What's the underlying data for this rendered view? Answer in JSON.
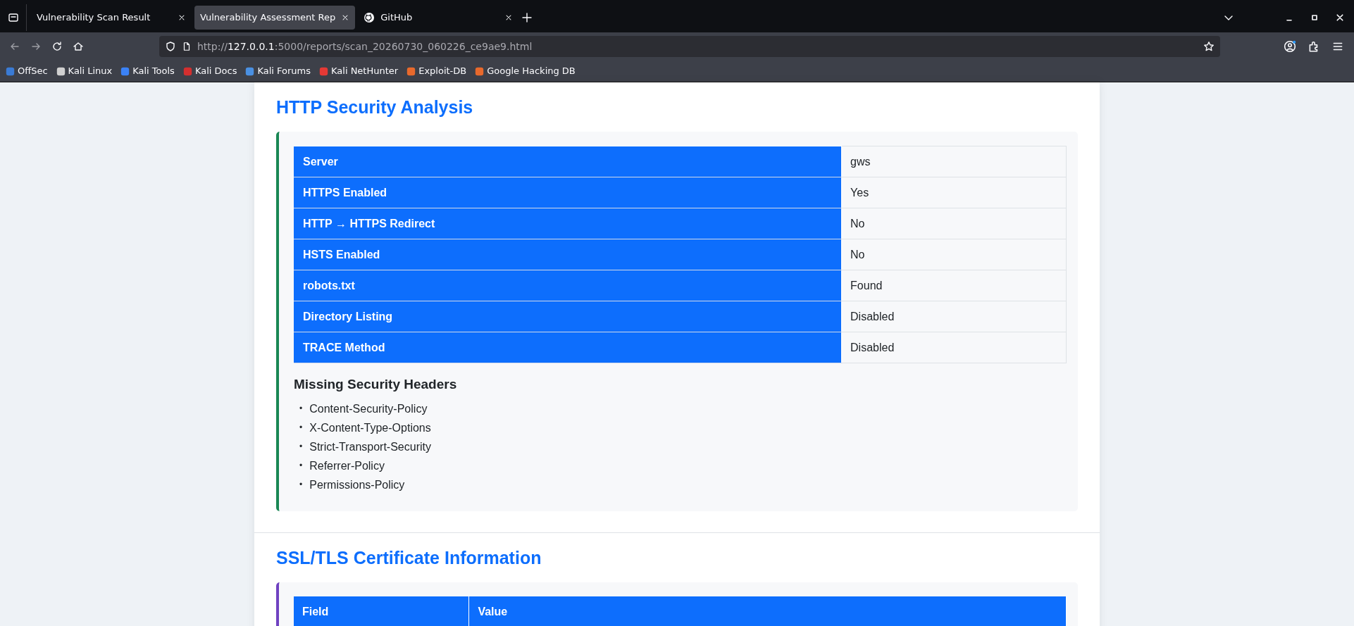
{
  "browser": {
    "tabs": [
      {
        "title": "Vulnerability Scan Result",
        "selected": false,
        "kind": "plain"
      },
      {
        "title": "Vulnerability Assessment Rep",
        "selected": true,
        "kind": "plain"
      },
      {
        "title": "GitHub",
        "selected": false,
        "kind": "github"
      }
    ],
    "address": {
      "scheme": "http://",
      "host": "127.0.0.1",
      "path": ":5000/reports/scan_20260730_060226_ce9ae9.html"
    },
    "bookmarks": [
      {
        "label": "OffSec",
        "color": "#3a7bd5"
      },
      {
        "label": "Kali Linux",
        "color": "#d0d0d0"
      },
      {
        "label": "Kali Tools",
        "color": "#3b82f6"
      },
      {
        "label": "Kali Docs",
        "color": "#d32f2f"
      },
      {
        "label": "Kali Forums",
        "color": "#4a90e2"
      },
      {
        "label": "Kali NetHunter",
        "color": "#e53935"
      },
      {
        "label": "Exploit-DB",
        "color": "#e8692c"
      },
      {
        "label": "Google Hacking DB",
        "color": "#e8692c"
      }
    ]
  },
  "sections": [
    {
      "title": "HTTP Security Analysis",
      "color": "#198754",
      "kind": "keyvalue",
      "rows": [
        {
          "key": "Server",
          "value": "gws"
        },
        {
          "key": "HTTPS Enabled",
          "value": "Yes"
        },
        {
          "key": "HTTP → HTTPS Redirect",
          "value": "No"
        },
        {
          "key": "HSTS Enabled",
          "value": "No"
        },
        {
          "key": "robots.txt",
          "value": "Found"
        },
        {
          "key": "Directory Listing",
          "value": "Disabled"
        },
        {
          "key": "TRACE Method",
          "value": "Disabled"
        }
      ],
      "subheading": "Missing Security Headers",
      "items": [
        {
          "marker": "•",
          "text": "Content-Security-Policy"
        },
        {
          "marker": "•",
          "text": "X-Content-Type-Options"
        },
        {
          "marker": "•",
          "text": "Strict-Transport-Security"
        },
        {
          "marker": "•",
          "text": "Referrer-Policy"
        },
        {
          "marker": "•",
          "text": "Permissions-Policy"
        }
      ]
    },
    {
      "title": "SSL/TLS Certificate Information",
      "color": "#6f42c1",
      "kind": "columns",
      "columns": [
        "Field",
        "Value"
      ]
    }
  ]
}
